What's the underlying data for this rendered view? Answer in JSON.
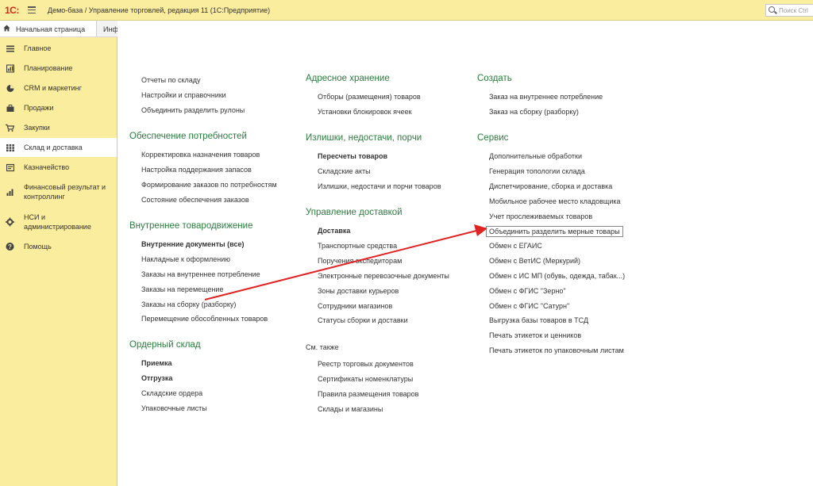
{
  "titlebar": {
    "logo": "1С:",
    "title": "Демо-база / Управление торговлей, редакция 11  (1С:Предприятие)",
    "search_placeholder": "Поиск Ctrl"
  },
  "tabs": {
    "home": "Начальная страница",
    "info": "Информация"
  },
  "sidebar": {
    "items": [
      {
        "label": "Главное",
        "icon": "menu-lines-icon"
      },
      {
        "label": "Планирование",
        "icon": "planning-icon"
      },
      {
        "label": "CRM и маркетинг",
        "icon": "pie-chart-icon"
      },
      {
        "label": "Продажи",
        "icon": "briefcase-icon"
      },
      {
        "label": "Закупки",
        "icon": "cart-icon"
      },
      {
        "label": "Склад и доставка",
        "icon": "warehouse-icon"
      },
      {
        "label": "Казначейство",
        "icon": "treasury-icon"
      },
      {
        "label": "Финансовый результат и контроллинг",
        "icon": "bar-chart-icon"
      },
      {
        "label": "НСИ и администрирование",
        "icon": "gear-icon"
      },
      {
        "label": "Помощь",
        "icon": "help-icon"
      }
    ]
  },
  "col1": {
    "top_items": [
      "Отчеты по складу",
      "Настройки и справочники",
      "Объединить разделить рулоны"
    ],
    "s1_title": "Обеспечение потребностей",
    "s1_items": [
      "Корректировка назначения товаров",
      "Настройка поддержания запасов",
      "Формирование заказов по потребностям",
      "Состояние обеспечения заказов"
    ],
    "s2_title": "Внутреннее товародвижение",
    "s2_items": [
      "Внутренние документы (все)",
      "Накладные к оформлению",
      "Заказы на внутреннее потребление",
      "Заказы на перемещение",
      "Заказы на сборку (разборку)",
      "Перемещение обособленных товаров"
    ],
    "s3_title": "Ордерный склад",
    "s3_items": [
      "Приемка",
      "Отгрузка",
      "Складские ордера",
      "Упаковочные листы"
    ]
  },
  "col2": {
    "s1_title": "Адресное хранение",
    "s1_items": [
      "Отборы (размещения) товаров",
      "Установки блокировок ячеек"
    ],
    "s2_title": "Излишки, недостачи, порчи",
    "s2_items": [
      "Пересчеты товаров",
      "Складские акты",
      "Излишки, недостачи и порчи товаров"
    ],
    "s3_title": "Управление доставкой",
    "s3_items": [
      "Доставка",
      "Транспортные средства",
      "Поручения экспедиторам",
      "Электронные перевозочные документы",
      "Зоны доставки курьеров",
      "Сотрудники магазинов",
      "Статусы сборки и доставки"
    ],
    "see_also": "См. также",
    "see_items": [
      "Реестр торговых документов",
      "Сертификаты номенклатуры",
      "Правила размещения товаров",
      "Склады и магазины"
    ]
  },
  "col3": {
    "s1_title": "Создать",
    "s1_items": [
      "Заказ на внутреннее потребление",
      "Заказ на сборку (разборку)"
    ],
    "s2_title": "Сервис",
    "s2_items": [
      "Дополнительные обработки",
      "Генерация топологии склада",
      "Диспетчирование, сборка и доставка",
      "Мобильное рабочее место кладовщика",
      "Учет прослеживаемых товаров",
      "Объединить разделить мерные товары",
      "Обмен с ЕГАИС",
      "Обмен с ВетИС (Меркурий)",
      "Обмен с ИС МП (обувь, одежда, табак...)",
      "Обмен с ФГИС \"Зерно\"",
      "Обмен с ФГИС \"Сатурн\"",
      "Выгрузка базы товаров в ТСД",
      "Печать этикеток и ценников",
      "Печать этикеток по упаковочным листам"
    ]
  },
  "colors": {
    "header_bg": "#fbed9e",
    "section_green": "#2a7d3e",
    "arrow_red": "#e02424"
  }
}
